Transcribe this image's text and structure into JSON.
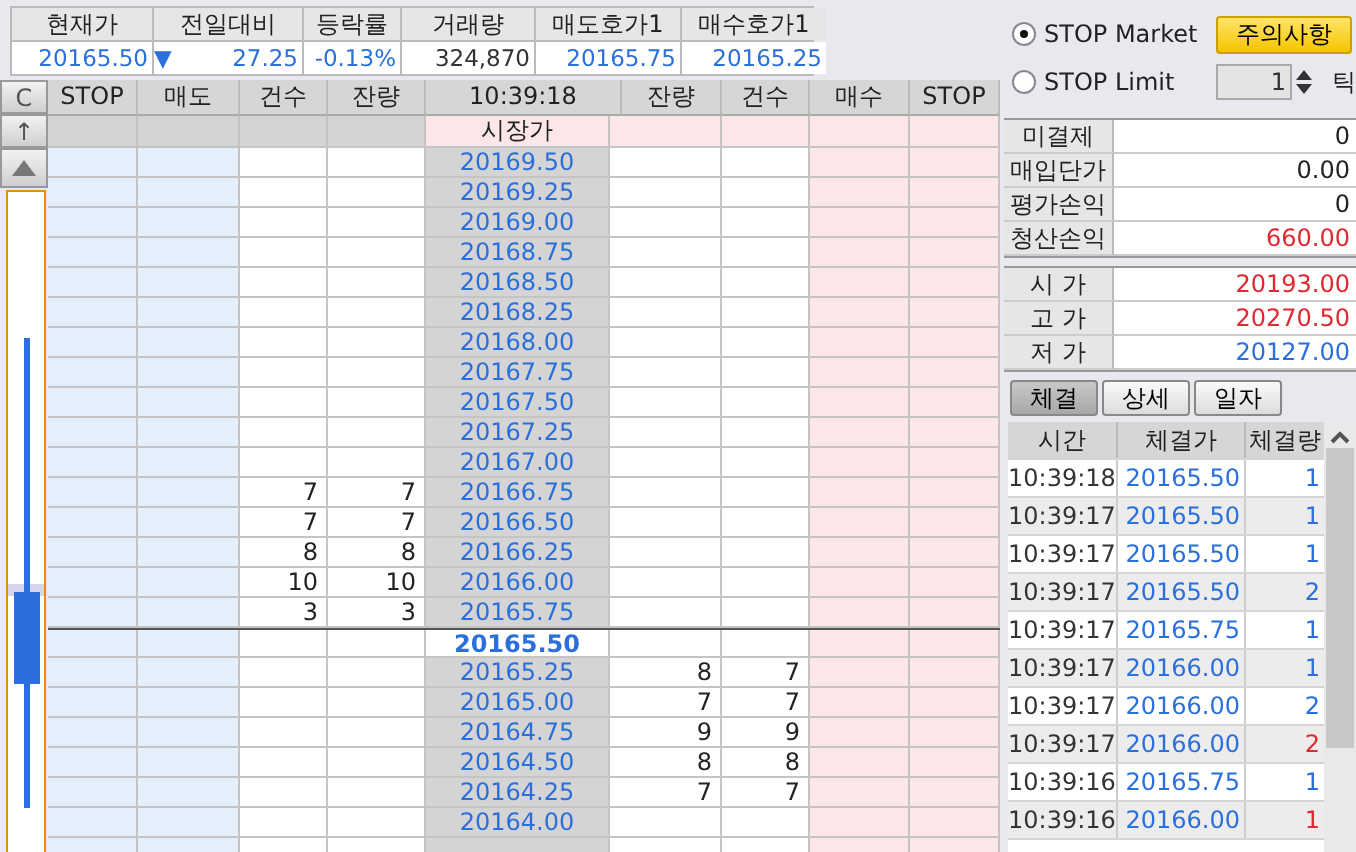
{
  "quote_header": {
    "columns": [
      "현재가",
      "전일대비",
      "등락률",
      "거래량",
      "매도호가1",
      "매수호가1"
    ],
    "values": [
      {
        "text": "20165.50",
        "color": "#2a6fdb"
      },
      {
        "text": "27.25",
        "color": "#2a6fdb",
        "arrow": "▼"
      },
      {
        "text": "-0.13%",
        "color": "#2a6fdb"
      },
      {
        "text": "324,870",
        "color": "#333333"
      },
      {
        "text": "20165.75",
        "color": "#2a6fdb"
      },
      {
        "text": "20165.25",
        "color": "#2a6fdb"
      }
    ]
  },
  "side_buttons": [
    "C",
    "↑"
  ],
  "ladder": {
    "columns": [
      "STOP",
      "매도",
      "건수",
      "잔량",
      "10:39:18",
      "잔량",
      "건수",
      "매수",
      "STOP"
    ],
    "market_label": "시장가",
    "rows": [
      {
        "price": "20169.50",
        "current": false
      },
      {
        "price": "20169.25",
        "current": false
      },
      {
        "price": "20169.00",
        "current": false
      },
      {
        "price": "20168.75",
        "current": false
      },
      {
        "price": "20168.50",
        "current": false
      },
      {
        "price": "20168.25",
        "current": false
      },
      {
        "price": "20168.00",
        "current": false
      },
      {
        "price": "20167.75",
        "current": false
      },
      {
        "price": "20167.50",
        "current": false
      },
      {
        "price": "20167.25",
        "current": false
      },
      {
        "price": "20167.00",
        "current": false
      },
      {
        "price": "20166.75",
        "sell_count": "7",
        "sell_qty": "7",
        "current": false
      },
      {
        "price": "20166.50",
        "sell_count": "7",
        "sell_qty": "7",
        "current": false
      },
      {
        "price": "20166.25",
        "sell_count": "8",
        "sell_qty": "8",
        "current": false
      },
      {
        "price": "20166.00",
        "sell_count": "10",
        "sell_qty": "10",
        "current": false
      },
      {
        "price": "20165.75",
        "sell_count": "3",
        "sell_qty": "3",
        "current": false
      },
      {
        "price": "20165.50",
        "current": true
      },
      {
        "price": "20165.25",
        "buy_qty": "8",
        "buy_count": "7",
        "current": false
      },
      {
        "price": "20165.00",
        "buy_qty": "7",
        "buy_count": "7",
        "current": false
      },
      {
        "price": "20164.75",
        "buy_qty": "9",
        "buy_count": "9",
        "current": false
      },
      {
        "price": "20164.50",
        "buy_qty": "8",
        "buy_count": "8",
        "current": false
      },
      {
        "price": "20164.25",
        "buy_qty": "7",
        "buy_count": "7",
        "current": false
      },
      {
        "price": "20164.00",
        "current": false
      }
    ]
  },
  "order_types": [
    {
      "label": "STOP Market",
      "selected": true
    },
    {
      "label": "STOP Limit",
      "selected": false
    }
  ],
  "notice_button": "주의사항",
  "tick_field": {
    "value": "1",
    "unit": "틱"
  },
  "position": [
    {
      "label": "미결제",
      "value": "0",
      "color": "#222222"
    },
    {
      "label": "매입단가",
      "value": "0.00",
      "color": "#222222"
    },
    {
      "label": "평가손익",
      "value": "0",
      "color": "#222222"
    },
    {
      "label": "청산손익",
      "value": "660.00",
      "color": "#e0282e"
    }
  ],
  "prices": [
    {
      "label": "시 가",
      "value": "20193.00",
      "color": "#e0282e"
    },
    {
      "label": "고 가",
      "value": "20270.50",
      "color": "#e0282e"
    },
    {
      "label": "저 가",
      "value": "20127.00",
      "color": "#2a6fdb"
    }
  ],
  "tabs": [
    {
      "label": "체결",
      "selected": true
    },
    {
      "label": "상세",
      "selected": false
    },
    {
      "label": "일자",
      "selected": false
    }
  ],
  "trades": {
    "columns": [
      "시간",
      "체결가",
      "체결량"
    ],
    "rows": [
      {
        "time": "10:39:18",
        "price": "20165.50",
        "qty": "1",
        "color": "#2a6fdb"
      },
      {
        "time": "10:39:17",
        "price": "20165.50",
        "qty": "1",
        "color": "#2a6fdb"
      },
      {
        "time": "10:39:17",
        "price": "20165.50",
        "qty": "1",
        "color": "#2a6fdb"
      },
      {
        "time": "10:39:17",
        "price": "20165.50",
        "qty": "2",
        "color": "#2a6fdb"
      },
      {
        "time": "10:39:17",
        "price": "20165.75",
        "qty": "1",
        "color": "#2a6fdb"
      },
      {
        "time": "10:39:17",
        "price": "20166.00",
        "qty": "1",
        "color": "#2a6fdb"
      },
      {
        "time": "10:39:17",
        "price": "20166.00",
        "qty": "2",
        "color": "#2a6fdb"
      },
      {
        "time": "10:39:17",
        "price": "20166.00",
        "qty": "2",
        "color": "#e0282e"
      },
      {
        "time": "10:39:16",
        "price": "20165.75",
        "qty": "1",
        "color": "#2a6fdb"
      },
      {
        "time": "10:39:16",
        "price": "20166.00",
        "qty": "1",
        "color": "#e0282e"
      }
    ]
  }
}
